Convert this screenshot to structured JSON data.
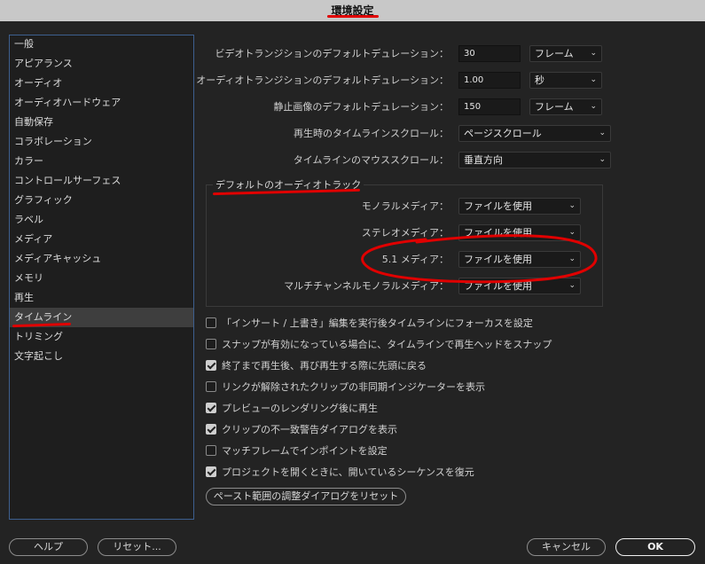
{
  "title": "環境設定",
  "sidebar": {
    "items": [
      {
        "label": "一般"
      },
      {
        "label": "アピアランス"
      },
      {
        "label": "オーディオ"
      },
      {
        "label": "オーディオハードウェア"
      },
      {
        "label": "自動保存"
      },
      {
        "label": "コラボレーション"
      },
      {
        "label": "カラー"
      },
      {
        "label": "コントロールサーフェス"
      },
      {
        "label": "グラフィック"
      },
      {
        "label": "ラベル"
      },
      {
        "label": "メディア"
      },
      {
        "label": "メディアキャッシュ"
      },
      {
        "label": "メモリ"
      },
      {
        "label": "再生"
      },
      {
        "label": "タイムライン",
        "selected": true
      },
      {
        "label": "トリミング"
      },
      {
        "label": "文字起こし"
      }
    ]
  },
  "settings": {
    "video_transition": {
      "label": "ビデオトランジションのデフォルトデュレーション：",
      "value": "30",
      "unit": "フレーム"
    },
    "audio_transition": {
      "label": "オーディオトランジションのデフォルトデュレーション：",
      "value": "1.00",
      "unit": "秒"
    },
    "still_image": {
      "label": "静止画像のデフォルトデュレーション：",
      "value": "150",
      "unit": "フレーム"
    },
    "playback_scroll": {
      "label": "再生時のタイムラインスクロール：",
      "value": "ページスクロール"
    },
    "mouse_scroll": {
      "label": "タイムラインのマウススクロール：",
      "value": "垂直方向"
    }
  },
  "audio_tracks": {
    "title": "デフォルトのオーディオトラック",
    "mono": {
      "label": "モノラルメディア：",
      "value": "ファイルを使用"
    },
    "stereo": {
      "label": "ステレオメディア：",
      "value": "ファイルを使用"
    },
    "surround": {
      "label": "5.1 メディア：",
      "value": "ファイルを使用"
    },
    "multichannel": {
      "label": "マルチチャンネルモノラルメディア：",
      "value": "ファイルを使用"
    }
  },
  "checkboxes": [
    {
      "label": "「インサート / 上書き」編集を実行後タイムラインにフォーカスを設定",
      "checked": false
    },
    {
      "label": "スナップが有効になっている場合に、タイムラインで再生ヘッドをスナップ",
      "checked": false
    },
    {
      "label": "終了まで再生後、再び再生する際に先頭に戻る",
      "checked": true
    },
    {
      "label": "リンクが解除されたクリップの非同期インジケーターを表示",
      "checked": false
    },
    {
      "label": "プレビューのレンダリング後に再生",
      "checked": true
    },
    {
      "label": "クリップの不一致警告ダイアログを表示",
      "checked": true
    },
    {
      "label": "マッチフレームでインポイントを設定",
      "checked": false
    },
    {
      "label": "プロジェクトを開くときに、開いているシーケンスを復元",
      "checked": true
    }
  ],
  "reset_paste_button": "ペースト範囲の調整ダイアログをリセット",
  "footer": {
    "help": "ヘルプ",
    "reset": "リセット...",
    "cancel": "キャンセル",
    "ok": "OK"
  },
  "annotation_color": "#e00000"
}
